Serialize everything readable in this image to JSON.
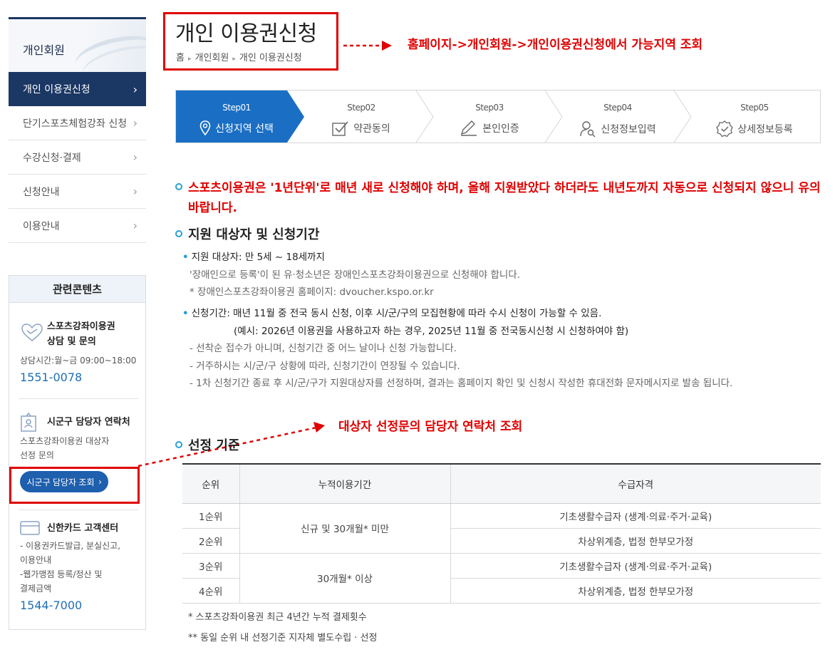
{
  "sidebar": {
    "title": "개인회원",
    "items": [
      {
        "label": "개인 이용권신청"
      },
      {
        "label": "단기스포츠체험강좌 신청"
      },
      {
        "label": "수강신청·결제"
      },
      {
        "label": "신청안내"
      },
      {
        "label": "이용안내"
      }
    ]
  },
  "related": {
    "title": "관련콘텐츠",
    "consult": {
      "title1": "스포츠강좌이용권",
      "title2": "상담 및 문의",
      "hours": "상담시간:월~금 09:00~18:00",
      "phone": "1551-0078"
    },
    "sigungu": {
      "title": "시군구 담당자 연락처",
      "desc1": "스포츠강좌이용권 대상자",
      "desc2": "선정 문의",
      "button": "시군구 담당자 조회"
    },
    "card": {
      "title": "신한카드 고객센터",
      "d1": "- 이용권카드발급, 분실신고,",
      "d2": "이용안내",
      "d3": "-웹가맹점 등록/정산 및",
      "d4": "결제금액",
      "phone": "1544-7000"
    }
  },
  "header": {
    "title": "개인 이용권신청",
    "breadcrumb": [
      "홈",
      "개인회원",
      "개인 이용권신청"
    ]
  },
  "annotations": {
    "top": "홈페이지->개인회원->개인이용권신청에서 가능지역 조회",
    "middle": "대상자 선정문의 담당자 연락처 조회"
  },
  "steps": [
    {
      "num": "Step01",
      "label": "신청지역 선택",
      "icon": "location-pin-icon"
    },
    {
      "num": "Step02",
      "label": "약관동의",
      "icon": "checkbox-icon"
    },
    {
      "num": "Step03",
      "label": "본인인증",
      "icon": "pen-icon"
    },
    {
      "num": "Step04",
      "label": "신청정보입력",
      "icon": "user-search-icon"
    },
    {
      "num": "Step05",
      "label": "상세정보등록",
      "icon": "check-circle-icon"
    }
  ],
  "content": {
    "notice": "스포츠이용권은 '1년단위'로 매년 새로 신청해야 하며, 올해 지원받았다 하더라도 내년도까지 자동으로 신청되지 않으니 유의 바랍니다.",
    "section1": {
      "title": "지원 대상자 및 신청기간",
      "target": "지원 대상자: 만 5세 ~ 18세까지",
      "target_l1": "'장애인으로 등록'이 된 유·청소년은 장애인스포츠강좌이용권으로 신청해야 합니다.",
      "target_l2": "* 장애인스포츠강좌이용권 홈페이지: dvoucher.kspo.or.kr",
      "period": "신청기간: 매년 11월 중 전국 동시 신청, 이후 시/군/구의 모집현황에 따라 수시 신청이 가능할 수 있음.",
      "period_ex": "(예시: 2026년 이용권을 사용하고자 하는 경우, 2025년 11월 중 전국동시신청 시 신청하여야 함)",
      "period_l1": "- 선착순 접수가 아니며, 신청기간 중 어느 날이나 신청 가능합니다.",
      "period_l2": "- 거주하시는 시/군/구 상황에 따라, 신청기간이 연장될 수 있습니다.",
      "period_l3": "- 1차 신청기간 종료 후 시/군/구가 지원대상자를 선정하며, 결과는 홈페이지 확인 및 신청시 작성한 휴대전화 문자메시지로 발송 됩니다."
    },
    "section2": {
      "title": "선정 기준",
      "headers": [
        "순위",
        "누적이용기간",
        "수급자격"
      ],
      "rows": [
        {
          "rank": "1순위",
          "period": "신규 및 30개월* 미만",
          "qual": "기초생활수급자 (생계·의료·주거·교육)"
        },
        {
          "rank": "2순위",
          "qual": "차상위계층, 법정 한부모가정"
        },
        {
          "rank": "3순위",
          "period": "30개월* 이상",
          "qual": "기초생활수급자 (생계·의료·주거·교육)"
        },
        {
          "rank": "4순위",
          "qual": "차상위계층, 법정 한부모가정"
        }
      ],
      "footnote1": "* 스포츠강좌이용권 최근 4년간 누적 결제횟수",
      "footnote2": "** 동일 순위 내 선정기준 지자체 별도수립 · 선정"
    }
  },
  "colors": {
    "navy": "#1b3764",
    "step_active": "#1a6fc4",
    "accent_blue": "#2a9fd8",
    "annotation_red": "#e00000",
    "phone_blue": "#1e6fb8"
  }
}
